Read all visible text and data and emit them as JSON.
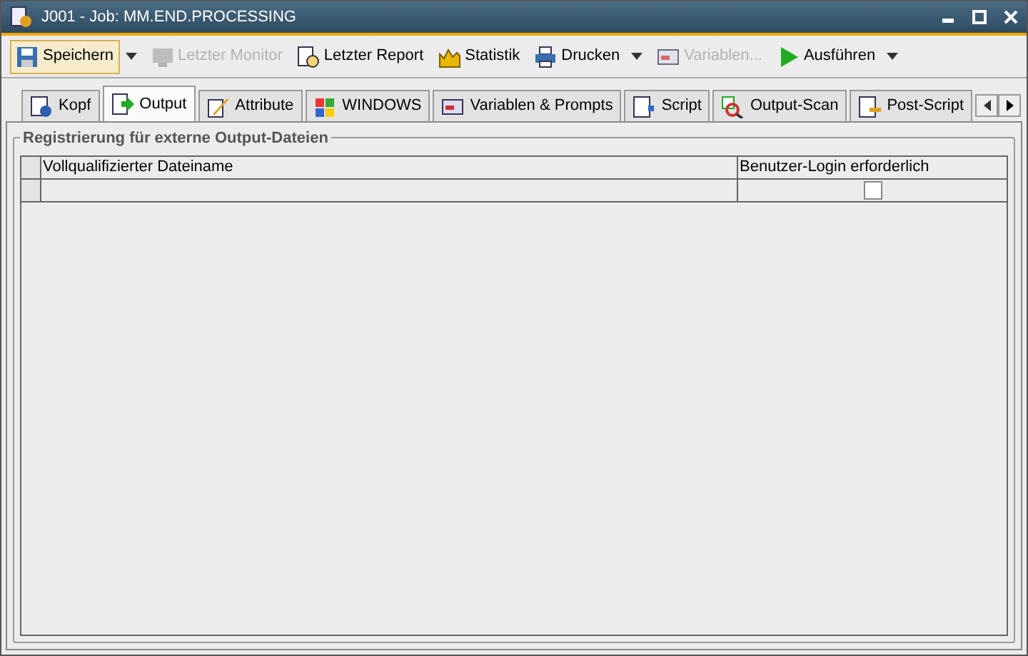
{
  "window": {
    "title": "J001 - Job: MM.END.PROCESSING"
  },
  "toolbar": [
    {
      "label": "Speichern",
      "kind": "save",
      "selected": true,
      "disabled": false,
      "dropdown": true
    },
    {
      "label": "Letzter Monitor",
      "kind": "monitor",
      "selected": false,
      "disabled": true,
      "dropdown": false
    },
    {
      "label": "Letzter Report",
      "kind": "report",
      "selected": false,
      "disabled": false,
      "dropdown": false
    },
    {
      "label": "Statistik",
      "kind": "chart",
      "selected": false,
      "disabled": false,
      "dropdown": false
    },
    {
      "label": "Drucken",
      "kind": "print",
      "selected": false,
      "disabled": false,
      "dropdown": true
    },
    {
      "label": "Variablen...",
      "kind": "vars",
      "selected": false,
      "disabled": true,
      "dropdown": false
    },
    {
      "label": "Ausführen",
      "kind": "play",
      "selected": false,
      "disabled": false,
      "dropdown": true
    }
  ],
  "tabs": [
    {
      "label": "Kopf",
      "kind": "info",
      "selected": false
    },
    {
      "label": "Output",
      "kind": "output",
      "selected": true
    },
    {
      "label": "Attribute",
      "kind": "pen",
      "selected": false
    },
    {
      "label": "WINDOWS",
      "kind": "windows",
      "selected": false
    },
    {
      "label": "Variablen & Prompts",
      "kind": "vars",
      "selected": false
    },
    {
      "label": "Script",
      "kind": "script",
      "selected": false
    },
    {
      "label": "Output-Scan",
      "kind": "scan",
      "selected": false
    },
    {
      "label": "Post-Script",
      "kind": "post",
      "selected": false
    }
  ],
  "group": {
    "title": "Registrierung für externe Output-Dateien",
    "table": {
      "columns": [
        "Vollqualifizierter Dateiname",
        "Benutzer-Login erforderlich"
      ],
      "rows": [
        {
          "file": "",
          "login_required": false
        }
      ]
    }
  }
}
